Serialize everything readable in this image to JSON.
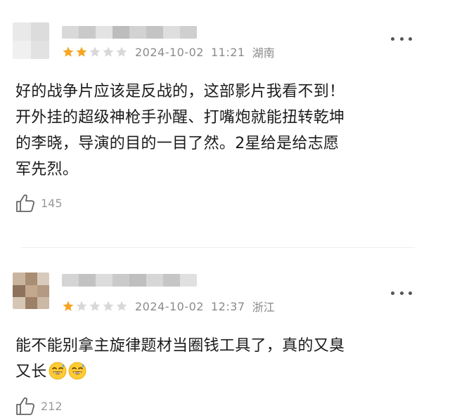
{
  "reviews": [
    {
      "rating": 2,
      "max_rating": 5,
      "date": "2024-10-02",
      "time": "11:21",
      "location": "湖南",
      "content_lines": [
        "好的战争片应该是反战的，这部影片我看不到！",
        "开外挂的超级神枪手孙醒、打嘴炮就能扭转乾坤",
        "的李晓，导演的目的一目了然。2星给是给志愿",
        "军先烈。"
      ],
      "likes": "145"
    },
    {
      "rating": 1,
      "max_rating": 5,
      "date": "2024-10-02",
      "time": "12:37",
      "location": "浙江",
      "content_lines": [
        "能不能别拿主旋律题材当圈钱工具了，真的又臭",
        "又长"
      ],
      "likes": "212"
    }
  ],
  "colors": {
    "star_filled": "#f5a623",
    "star_empty": "#d8d8d8",
    "meta_text": "#8a8a8a"
  },
  "icons": {
    "like": "thumbs-up-icon",
    "more": "more-dots-icon",
    "star": "star-icon",
    "emoji": "sweat-smile-emoji"
  }
}
